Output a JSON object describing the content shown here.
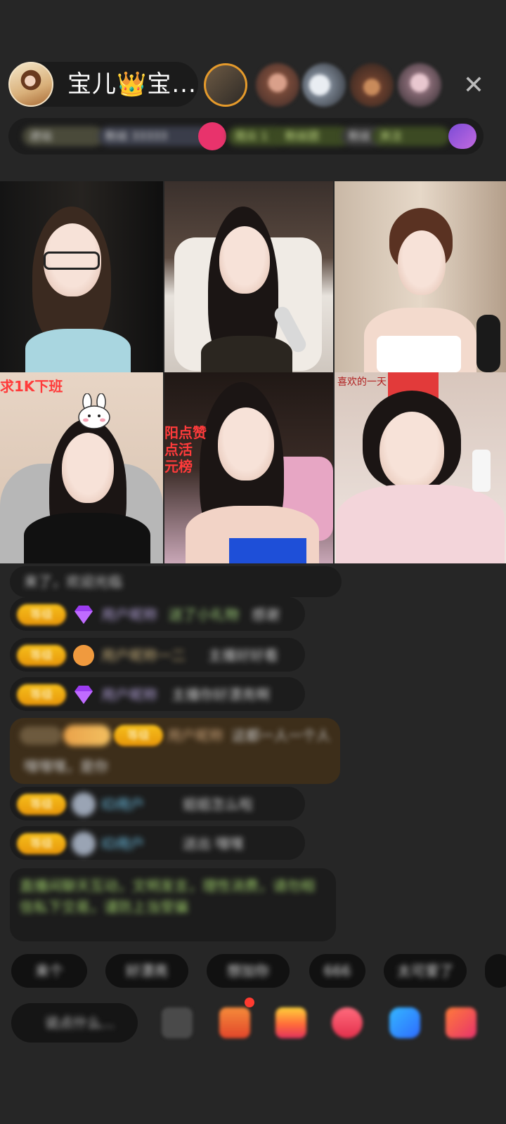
{
  "host": {
    "name": "宝儿👑宝..."
  },
  "top_viewers": [
    "viewer 1",
    "viewer 2",
    "viewer 3",
    "viewer 4",
    "viewer 5"
  ],
  "tags": [
    "进站",
    "粉丝 33333",
    "观众 1",
    "粉丝团",
    "粉丝",
    "关注"
  ],
  "grid": {
    "tiles": [
      {
        "label": ""
      },
      {
        "label": ""
      },
      {
        "label": ""
      },
      {
        "label": "求1K下班"
      },
      {
        "label": "阳点赞\n点活\n元榜"
      },
      {
        "label": "喜欢的一天"
      }
    ]
  },
  "chat": {
    "entry": "来了，欢迎光临",
    "messages": [
      {
        "badge": "等级",
        "user": "用户昵称",
        "text": "送了小礼物",
        "extra": "感谢"
      },
      {
        "badge": "等级",
        "user": "用户昵称一二",
        "text": "主播好好看"
      },
      {
        "badge": "等级",
        "user": "用户昵称",
        "text": "主播你好漂亮啊"
      },
      {
        "badge": "等级",
        "user": "用户昵称",
        "text": "这都一人一个人"
      },
      {
        "badge": "等级",
        "user": "ID用户",
        "text": "姐姐怎么啦"
      },
      {
        "badge": "等级",
        "user": "ID用户",
        "text": "送出 嘿嘿"
      }
    ],
    "notice": "直播间聊天互动，文明发言，理性消费，请勿相信私下交易，谨防上当受骗"
  },
  "quick_replies": [
    "来个",
    "好漂亮",
    "想加你",
    "666",
    "太可爱了",
    ""
  ],
  "bottom": {
    "input_placeholder": "说点什么...",
    "icons": [
      "expression-icon",
      "gift-box-icon",
      "treasure-icon",
      "game-icon",
      "chat-bubble-icon",
      "more-icon"
    ]
  }
}
